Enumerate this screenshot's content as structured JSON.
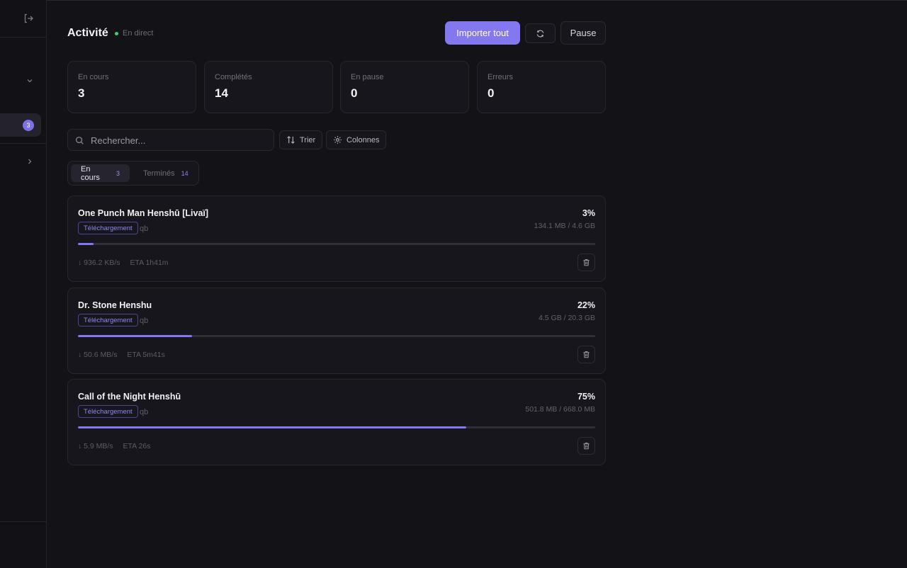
{
  "sidebar": {
    "badge_count": "3"
  },
  "header": {
    "title": "Activité",
    "live_label": "En direct",
    "import_all_label": "Importer tout",
    "pause_label": "Pause"
  },
  "stats": [
    {
      "label": "En cours",
      "value": "3"
    },
    {
      "label": "Complétés",
      "value": "14"
    },
    {
      "label": "En pause",
      "value": "0"
    },
    {
      "label": "Erreurs",
      "value": "0"
    }
  ],
  "toolbar": {
    "search_placeholder": "Rechercher...",
    "sort_label": "Trier",
    "columns_label": "Colonnes"
  },
  "tabs": [
    {
      "label": "En cours",
      "count": "3",
      "active": true
    },
    {
      "label": "Terminés",
      "count": "14",
      "active": false
    }
  ],
  "downloads": [
    {
      "title": "One Punch Man Henshū [Livaï]",
      "status": "Téléchargement",
      "client": "qb",
      "percent_label": "3%",
      "progress": 0.03,
      "size": "134.1 MB / 4.6 GB",
      "speed": "↓ 936.2 KB/s",
      "eta": "ETA 1h41m"
    },
    {
      "title": "Dr. Stone Henshu",
      "status": "Téléchargement",
      "client": "qb",
      "percent_label": "22%",
      "progress": 0.22,
      "size": "4.5 GB / 20.3 GB",
      "speed": "↓ 50.6 MB/s",
      "eta": "ETA 5m41s"
    },
    {
      "title": "Call of the Night Henshū",
      "status": "Téléchargement",
      "client": "qb",
      "percent_label": "75%",
      "progress": 0.75,
      "size": "501.8 MB / 668.0 MB",
      "speed": "↓ 5.9 MB/s",
      "eta": "ETA 26s"
    }
  ],
  "colors": {
    "accent": "#8478f0",
    "live": "#3ecf6e",
    "background": "#131217",
    "card": "#17161c"
  }
}
